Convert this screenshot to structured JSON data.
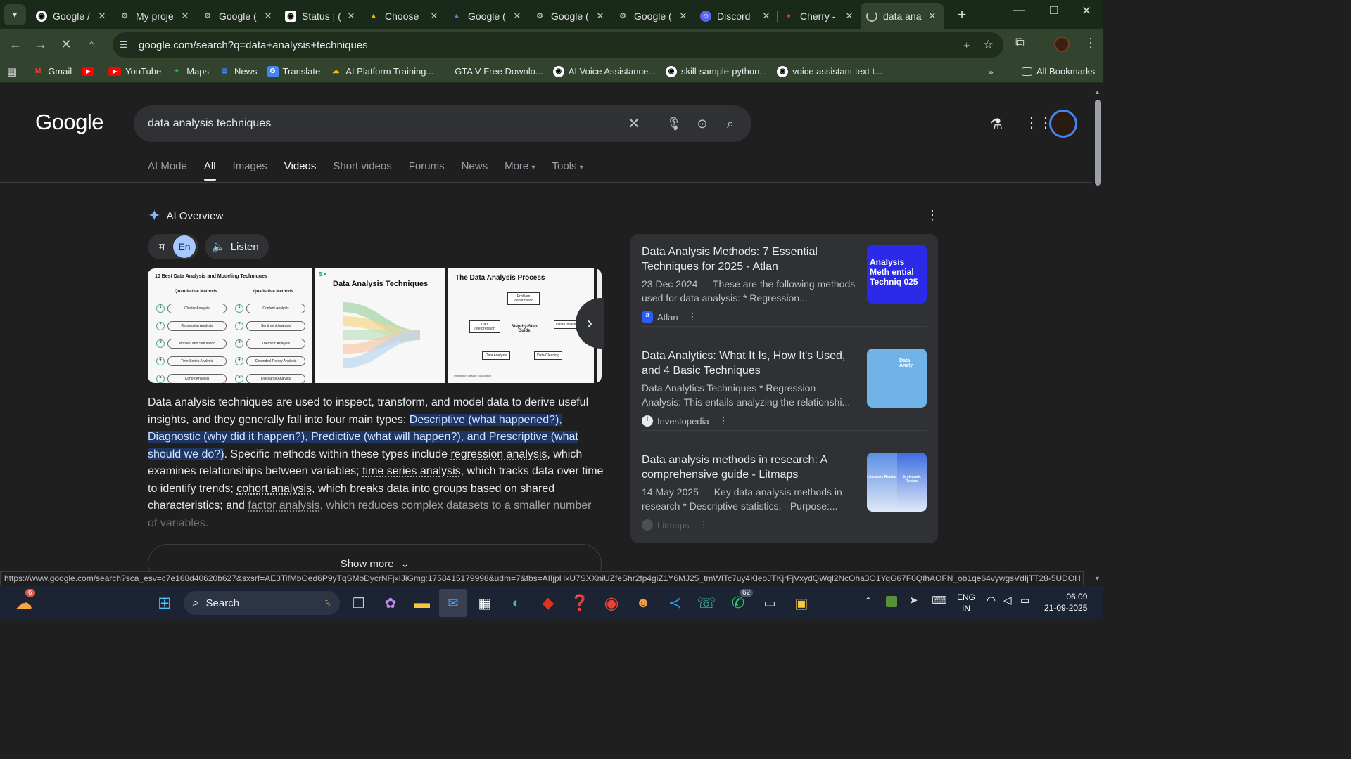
{
  "browser": {
    "tabs": [
      {
        "title": "Google /",
        "icon": "github-icon"
      },
      {
        "title": "My proje",
        "icon": "globe-icon"
      },
      {
        "title": "Google (",
        "icon": "globe-icon"
      },
      {
        "title": "Status | (",
        "icon": "github-icon"
      },
      {
        "title": "Choose",
        "icon": "drive-icon"
      },
      {
        "title": "Google (",
        "icon": "drive-icon"
      },
      {
        "title": "Google (",
        "icon": "globe-icon"
      },
      {
        "title": "Google (",
        "icon": "globe-icon"
      },
      {
        "title": "Discord",
        "icon": "discord-icon"
      },
      {
        "title": "Cherry -",
        "icon": "cherry-icon"
      },
      {
        "title": "data ana",
        "icon": "loading-icon"
      }
    ],
    "url": "google.com/search?q=data+analysis+techniques",
    "bookmarks": [
      {
        "label": "Gmail",
        "icon": "gmail-icon"
      },
      {
        "label": "",
        "icon": "youtube-icon"
      },
      {
        "label": "YouTube",
        "icon": "youtube-icon"
      },
      {
        "label": "Maps",
        "icon": "maps-icon"
      },
      {
        "label": "News",
        "icon": "news-icon"
      },
      {
        "label": "Translate",
        "icon": "translate-icon"
      },
      {
        "label": "AI Platform Training...",
        "icon": "cloud-icon"
      },
      {
        "label": "GTA V Free Downlo...",
        "icon": "blank-icon"
      },
      {
        "label": "AI Voice Assistance...",
        "icon": "github-icon"
      },
      {
        "label": "skill-sample-python...",
        "icon": "github-icon"
      },
      {
        "label": "voice assistant text t...",
        "icon": "github-icon"
      }
    ],
    "all_bookmarks": "All Bookmarks",
    "status_url": "https://www.google.com/search?sca_esv=c7e168d40620b627&sxsrf=AE3TifMbOed6P9yTqSMoDycrNFjxIJiGmg:1758415179998&udm=7&fbs=AIIjpHxU7SXXniUZfeShr2fp4giZ1Y6MJ25_tmWITc7uy4KleoJTKjrFjVxydQWql2NcOha3O1YqG67F0QIhAOFN_ob1qe64vywgsVdIjTT28-5UDOH..."
  },
  "search": {
    "logo": "Google",
    "query": "data analysis techniques",
    "tabs": [
      "AI Mode",
      "All",
      "Images",
      "Videos",
      "Short videos",
      "Forums",
      "News",
      "More",
      "Tools"
    ]
  },
  "ai_overview": {
    "title": "AI Overview",
    "lang_hi": "म",
    "lang_en": "En",
    "listen": "Listen",
    "images": [
      {
        "title": "10 Best Data Analysis and Modeling Techniques",
        "left_header": "Quantitative Methods",
        "right_header": "Qualitative Methods",
        "left": [
          "Cluster Analysis",
          "Regression Analysis",
          "Monte Carlo Simulation",
          "Time Series Analysis",
          "Cohort Analysis"
        ],
        "right": [
          "Content Analysis",
          "Sentiment Analysis",
          "Thematic Analysis",
          "Grounded Theory Analysis",
          "Discourse Analysis"
        ]
      },
      {
        "title": "Data Analysis Techniques",
        "brand": "S✕"
      },
      {
        "title": "The Data Analysis Process",
        "steps": [
          "Problem Identification",
          "Data Collection",
          "Data Cleaning",
          "Data Analysis",
          "Data Interpretation"
        ],
        "center": "Step-by-Step Guide",
        "footer": "Interaction Design Foundation"
      }
    ],
    "text": {
      "p1": "Data analysis techniques are used to inspect, transform, and model data to derive useful insights, and they generally fall into four main types: ",
      "highlight": "Descriptive (what happened?), Diagnostic (why did it happen?), Predictive (what will happen?), and Prescriptive (what should we do?)",
      "p2": ". Specific methods within these types include ",
      "t1": "regression analysis",
      "p3": ", which examines relationships between variables; ",
      "t2": "time series analysis",
      "p4": ", which tracks data over time to identify trends; ",
      "t3": "cohort analysis",
      "p5": ", which breaks data into groups based on shared characteristics; and ",
      "t4": "factor analysis",
      "p6": ", which reduces complex datasets to a smaller number ",
      "p7": "of variables."
    },
    "show_more": "Show more"
  },
  "sources": [
    {
      "title": "Data Analysis Methods: 7 Essential Techniques for 2025 - Atlan",
      "desc": "23 Dec 2024 — These are the following methods used for data analysis: * Regression...",
      "site": "Atlan",
      "thumb_text": "Analysis Meth ential Techniq 025"
    },
    {
      "title": "Data Analytics: What It Is, How It's Used, and 4 Basic Techniques",
      "desc": "Data Analytics Techniques * Regression Analysis: This entails analyzing the relationshi...",
      "site": "Investopedia",
      "thumb_text": "Data Analy"
    },
    {
      "title": "Data analysis methods in research: A comprehensive guide - Litmaps",
      "desc": "14 May 2025 — Key data analysis methods in research * Descriptive statistics. - Purpose:...",
      "site": "Litmaps",
      "thumb_left": "Literature Review",
      "thumb_right": "Systematic Review"
    }
  ],
  "taskbar": {
    "weather_badge": "6",
    "search": "Search",
    "whatsapp_badge": "62",
    "lang": "ENG",
    "region": "IN",
    "time": "06:09",
    "date": "21-09-2025"
  },
  "colors": {
    "tabbar": "#1a2a1a",
    "toolbar": "#32442e",
    "page_bg": "#1f1f1f",
    "highlight": "#1d3665"
  }
}
